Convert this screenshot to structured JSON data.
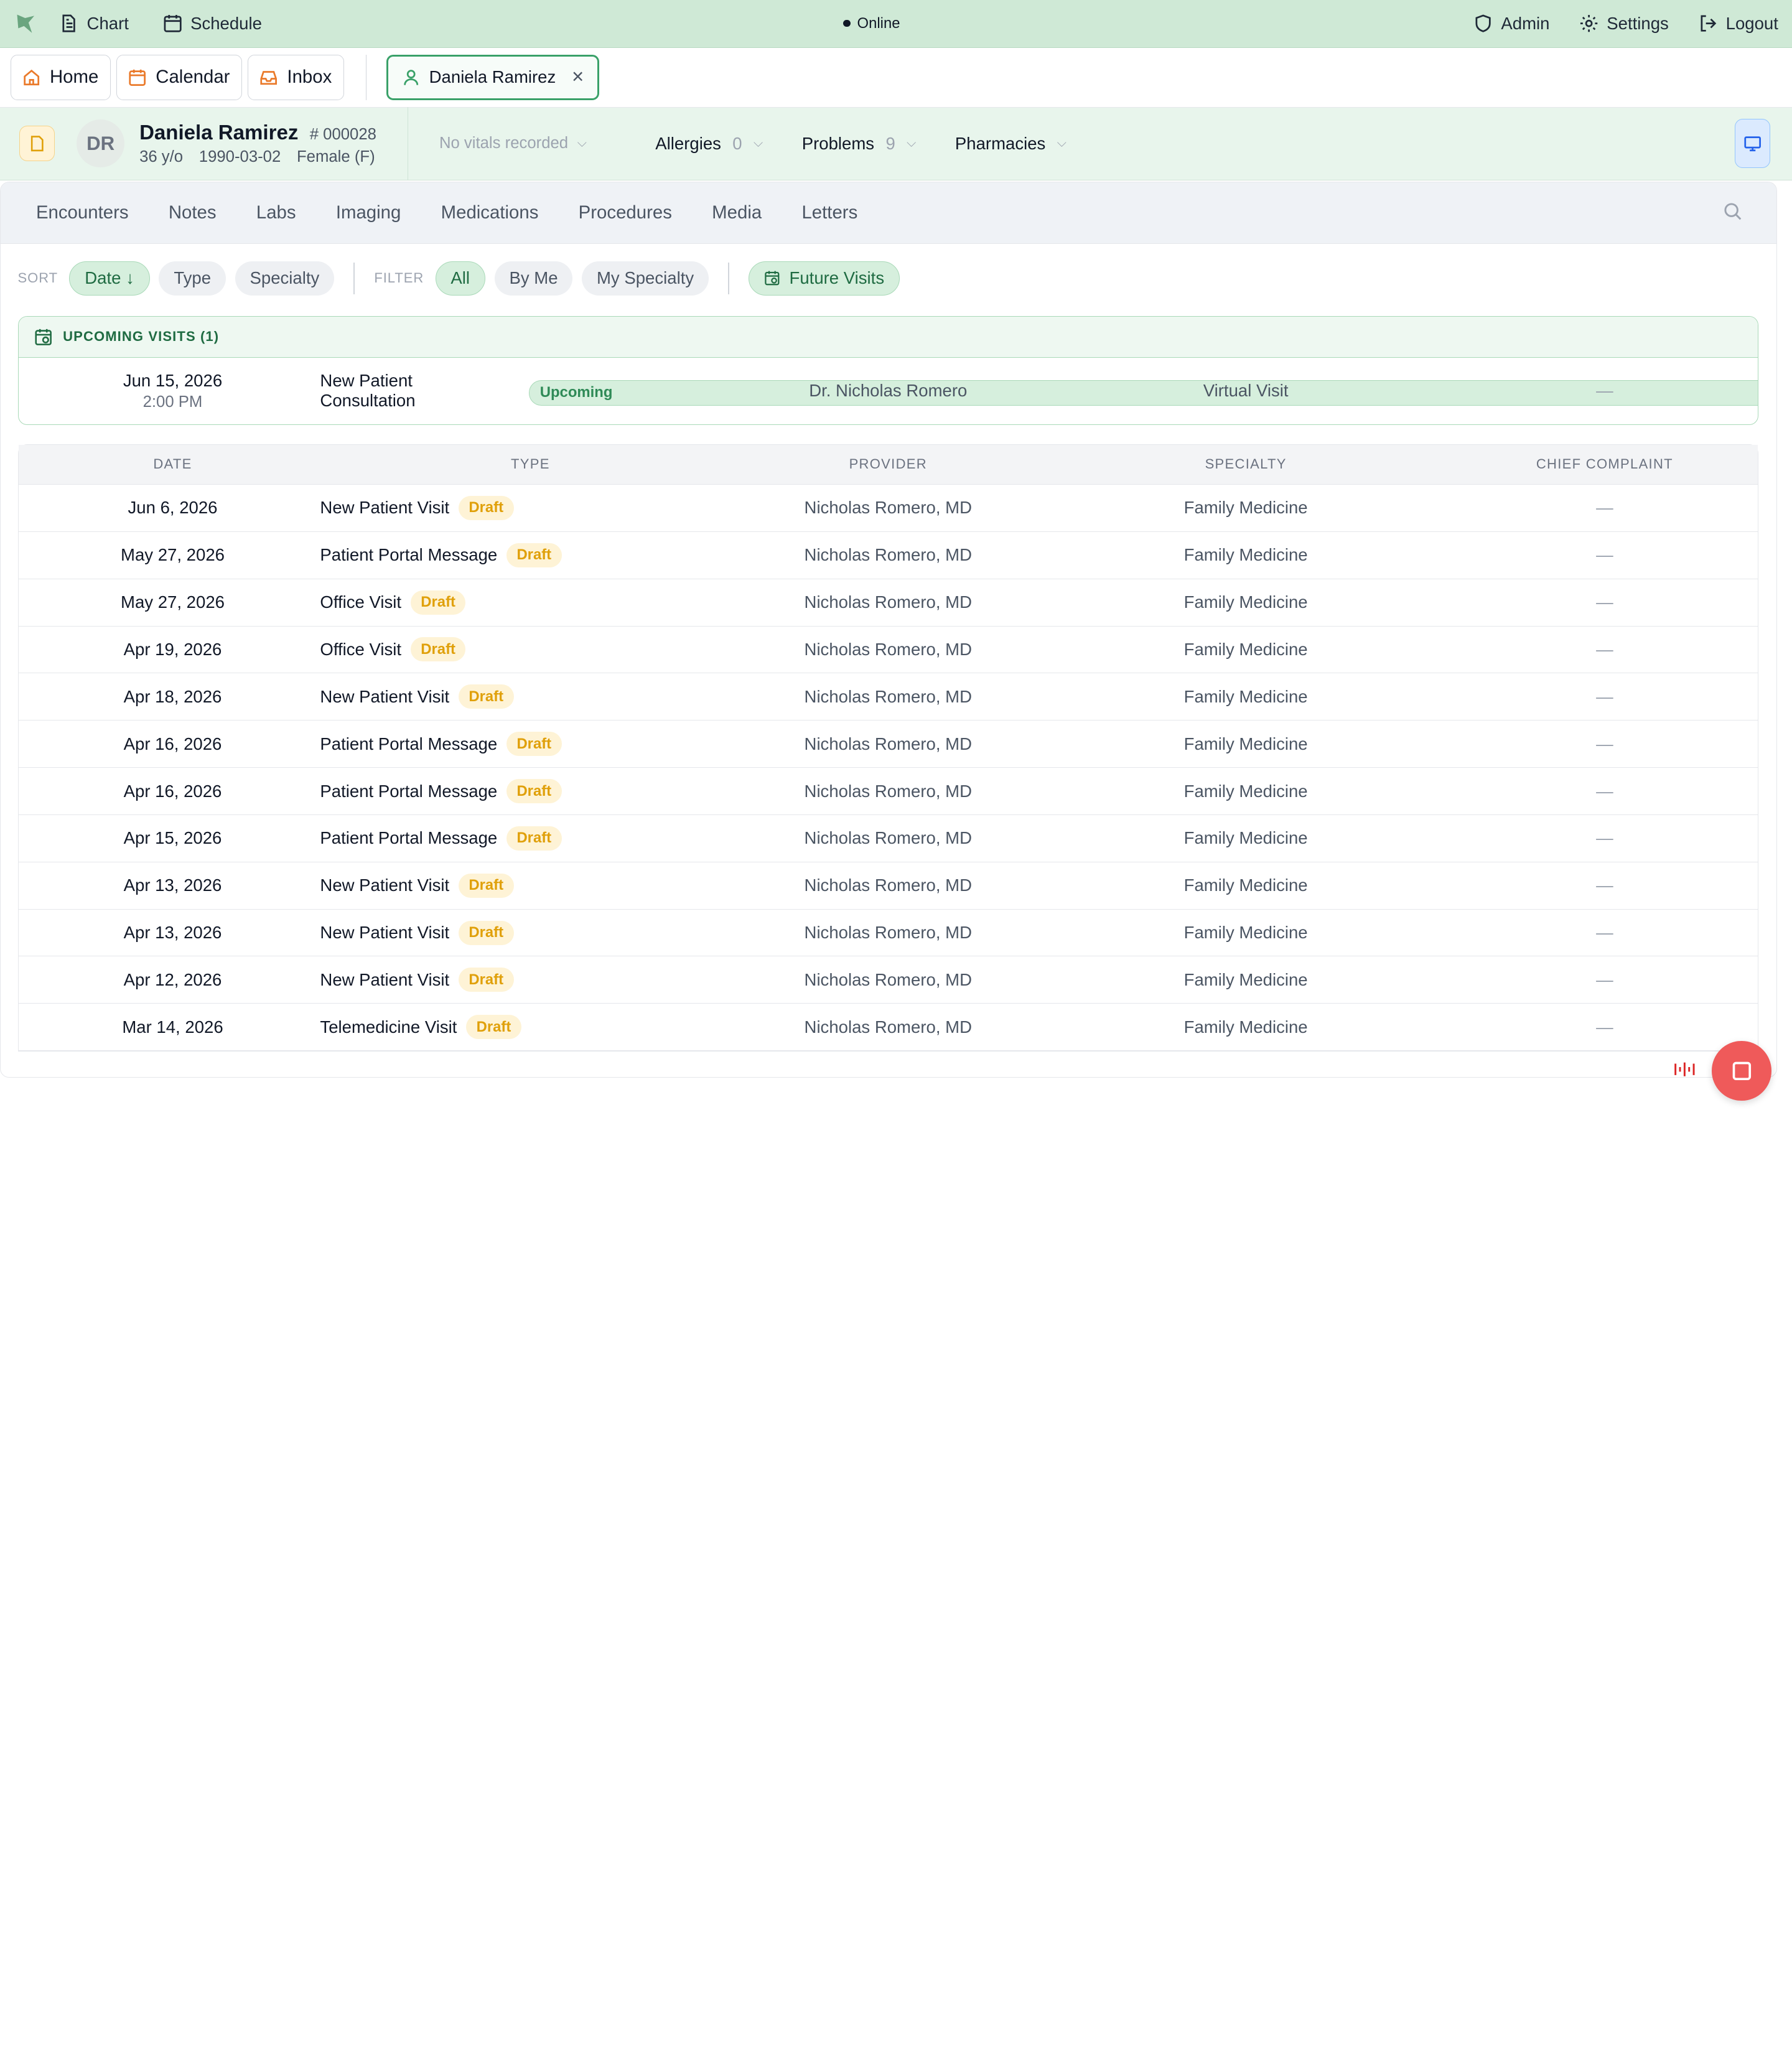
{
  "topbar": {
    "nav": [
      {
        "label": "Chart",
        "icon": "document-icon"
      },
      {
        "label": "Schedule",
        "icon": "calendar-icon"
      }
    ],
    "status": "Online",
    "right": [
      {
        "label": "Admin",
        "icon": "shield-icon"
      },
      {
        "label": "Settings",
        "icon": "gear-icon"
      },
      {
        "label": "Logout",
        "icon": "logout-icon"
      }
    ]
  },
  "tabs": [
    {
      "label": "Home",
      "icon": "home-icon"
    },
    {
      "label": "Calendar",
      "icon": "calendar-icon"
    },
    {
      "label": "Inbox",
      "icon": "inbox-icon"
    }
  ],
  "active_tab": {
    "label": "Daniela Ramirez",
    "close": "×"
  },
  "patient": {
    "initials": "DR",
    "name": "Daniela Ramirez",
    "mrn": "# 000028",
    "age": "36 y/o",
    "dob": "1990-03-02",
    "sex": "Female (F)",
    "vitals": "No vitals recorded",
    "allergies": {
      "label": "Allergies",
      "count": "0"
    },
    "problems": {
      "label": "Problems",
      "count": "9"
    },
    "pharmacies": {
      "label": "Pharmacies"
    }
  },
  "subtabs": [
    "Encounters",
    "Notes",
    "Labs",
    "Imaging",
    "Medications",
    "Procedures",
    "Media",
    "Letters"
  ],
  "filters": {
    "sort_label": "SORT",
    "sort": [
      "Date ↓",
      "Type",
      "Specialty"
    ],
    "filter_label": "FILTER",
    "filter": [
      "All",
      "By Me",
      "My Specialty"
    ],
    "future": "Future Visits"
  },
  "upcoming": {
    "title": "UPCOMING VISITS (1)",
    "row": {
      "date": "Jun 15, 2026",
      "time": "2:00 PM",
      "type": "New Patient Consultation",
      "badge": "Upcoming",
      "provider": "Dr. Nicholas Romero",
      "specialty": "Virtual Visit",
      "cc": "—"
    }
  },
  "table": {
    "headers": {
      "date": "DATE",
      "type": "TYPE",
      "provider": "PROVIDER",
      "specialty": "SPECIALTY",
      "cc": "CHIEF COMPLAINT"
    },
    "rows": [
      {
        "date": "Jun 6, 2026",
        "type": "New Patient Visit",
        "badge": "Draft",
        "provider": "Nicholas Romero, MD",
        "specialty": "Family Medicine",
        "cc": "—"
      },
      {
        "date": "May 27, 2026",
        "type": "Patient Portal Message",
        "badge": "Draft",
        "provider": "Nicholas Romero, MD",
        "specialty": "Family Medicine",
        "cc": "—"
      },
      {
        "date": "May 27, 2026",
        "type": "Office Visit",
        "badge": "Draft",
        "provider": "Nicholas Romero, MD",
        "specialty": "Family Medicine",
        "cc": "—"
      },
      {
        "date": "Apr 19, 2026",
        "type": "Office Visit",
        "badge": "Draft",
        "provider": "Nicholas Romero, MD",
        "specialty": "Family Medicine",
        "cc": "—"
      },
      {
        "date": "Apr 18, 2026",
        "type": "New Patient Visit",
        "badge": "Draft",
        "provider": "Nicholas Romero, MD",
        "specialty": "Family Medicine",
        "cc": "—"
      },
      {
        "date": "Apr 16, 2026",
        "type": "Patient Portal Message",
        "badge": "Draft",
        "provider": "Nicholas Romero, MD",
        "specialty": "Family Medicine",
        "cc": "—"
      },
      {
        "date": "Apr 16, 2026",
        "type": "Patient Portal Message",
        "badge": "Draft",
        "provider": "Nicholas Romero, MD",
        "specialty": "Family Medicine",
        "cc": "—"
      },
      {
        "date": "Apr 15, 2026",
        "type": "Patient Portal Message",
        "badge": "Draft",
        "provider": "Nicholas Romero, MD",
        "specialty": "Family Medicine",
        "cc": "—"
      },
      {
        "date": "Apr 13, 2026",
        "type": "New Patient Visit",
        "badge": "Draft",
        "provider": "Nicholas Romero, MD",
        "specialty": "Family Medicine",
        "cc": "—"
      },
      {
        "date": "Apr 13, 2026",
        "type": "New Patient Visit",
        "badge": "Draft",
        "provider": "Nicholas Romero, MD",
        "specialty": "Family Medicine",
        "cc": "—"
      },
      {
        "date": "Apr 12, 2026",
        "type": "New Patient Visit",
        "badge": "Draft",
        "provider": "Nicholas Romero, MD",
        "specialty": "Family Medicine",
        "cc": "—"
      },
      {
        "date": "Mar 14, 2026",
        "type": "Telemedicine Visit",
        "badge": "Draft",
        "provider": "Nicholas Romero, MD",
        "specialty": "Family Medicine",
        "cc": "—"
      }
    ]
  },
  "colors": {
    "accent": "#3aa169",
    "topbar": "#cfe9d6",
    "draft": "#e0a00a",
    "fab": "#ef5a5a"
  }
}
